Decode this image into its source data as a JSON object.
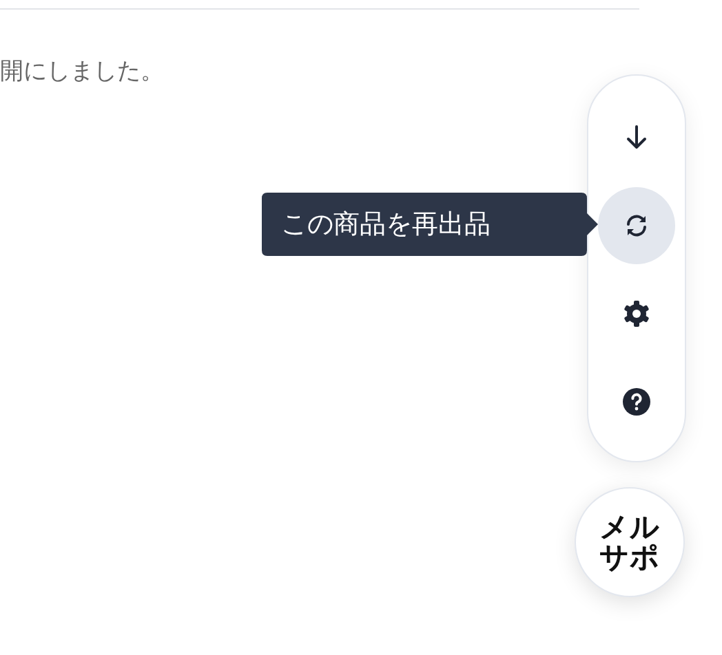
{
  "message": "開にしました。",
  "toolbar": {
    "buttons": [
      {
        "kind": "download",
        "selected": false
      },
      {
        "kind": "relist",
        "selected": true
      },
      {
        "kind": "settings",
        "selected": false
      },
      {
        "kind": "help",
        "selected": false
      }
    ]
  },
  "tooltip": "この商品を再出品",
  "fab": {
    "lines": [
      "メル",
      "サポ"
    ]
  }
}
